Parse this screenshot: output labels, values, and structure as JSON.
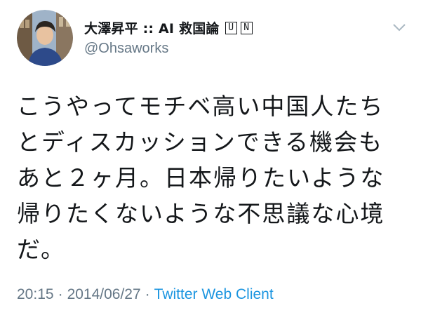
{
  "tweet": {
    "display_name": "大澤昇平 :: AI 救国論",
    "badges": [
      "U",
      "N"
    ],
    "username": "@Ohsaworks",
    "text_lines": [
      "こうやってモチベ高い中国人たち",
      "とディスカッションできる機会も",
      "あと２ヶ月。日本帰りたいような",
      "帰りたくないような不思議な心境",
      "だ。"
    ],
    "time": "20:15",
    "separator": "·",
    "date": "2014/06/27",
    "client": "Twitter Web Client"
  },
  "icons": {
    "avatar": "avatar-photo",
    "menu": "chevron-down-icon"
  },
  "colors": {
    "text": "#14171a",
    "secondary": "#657786",
    "link": "#1b95e0",
    "background": "#ffffff"
  }
}
